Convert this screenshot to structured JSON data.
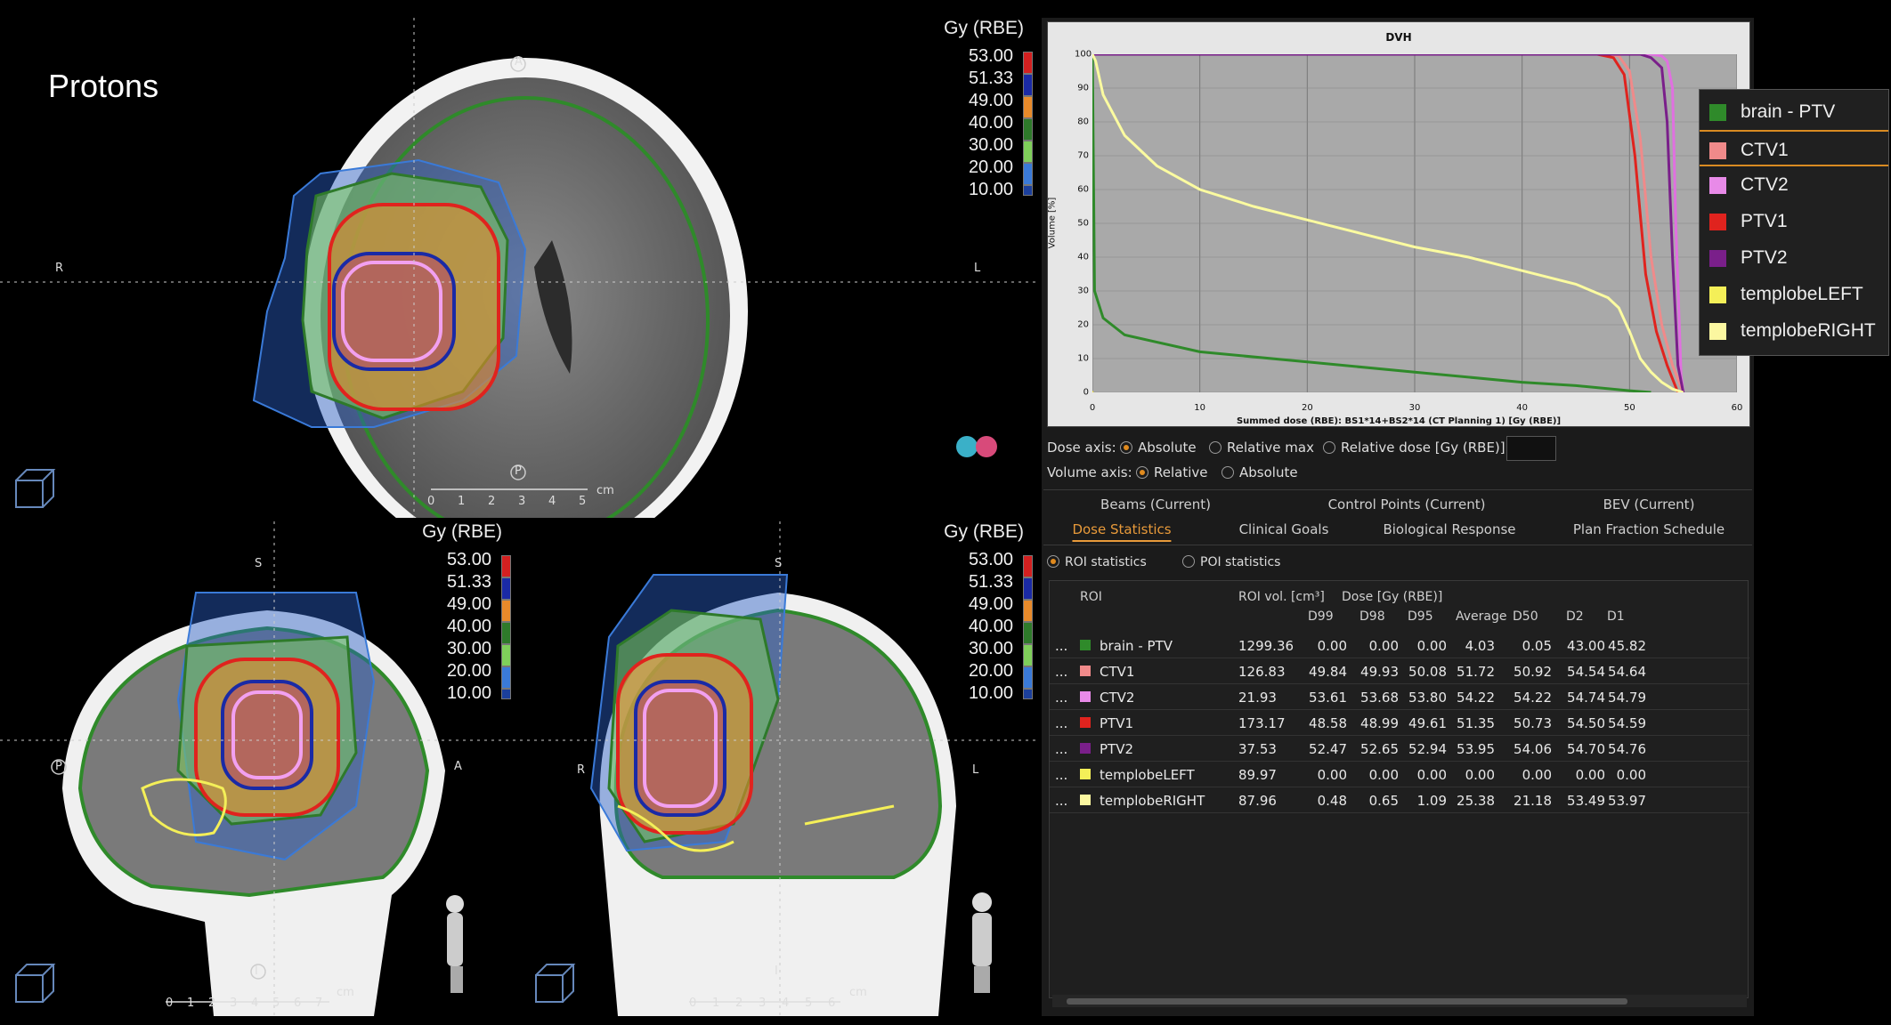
{
  "axial": {
    "title": "Protons",
    "orient": {
      "top": "A",
      "bottom": "P",
      "left": "R",
      "right": "L"
    },
    "ruler_unit": "cm",
    "ruler_ticks": [
      "0",
      "1",
      "2",
      "3",
      "4",
      "5"
    ]
  },
  "sagittal": {
    "orient": {
      "top": "S",
      "bottom": "I",
      "left": "P",
      "right": "A"
    },
    "ruler_unit": "cm",
    "ruler_ticks": [
      "0",
      "1",
      "2",
      "3",
      "4",
      "5",
      "6",
      "7"
    ]
  },
  "coronal": {
    "orient": {
      "top": "S",
      "bottom": "I",
      "left": "R",
      "right": "L"
    },
    "ruler_unit": "cm",
    "ruler_ticks": [
      "0",
      "1",
      "2",
      "3",
      "4",
      "5",
      "6"
    ]
  },
  "dose_legend": {
    "title": "Gy (RBE)",
    "levels": [
      "53.00",
      "51.33",
      "49.00",
      "40.00",
      "30.00",
      "20.00",
      "10.00"
    ],
    "colors": [
      "#d42020",
      "#1a2aa6",
      "#e88a2a",
      "#2e7a2a",
      "#7fcf5a",
      "#3a7ad8",
      "#1b3f9c"
    ]
  },
  "dvh": {
    "title": "DVH",
    "xlabel": "Summed dose (RBE): BS1*14+BS2*14 (CT Planning 1) [Gy (RBE)]",
    "ylabel": "Volume [%]",
    "xticks": [
      "0",
      "10",
      "20",
      "30",
      "40",
      "50",
      "60"
    ],
    "yticks": [
      "100",
      "90",
      "80",
      "70",
      "60",
      "50",
      "40",
      "30",
      "20",
      "10",
      "0"
    ]
  },
  "chart_data": {
    "type": "line",
    "title": "DVH",
    "xlabel": "Summed dose (RBE): BS1*14+BS2*14 (CT Planning 1) [Gy (RBE)]",
    "ylabel": "Volume [%]",
    "xlim": [
      0,
      60
    ],
    "ylim": [
      0,
      100
    ],
    "grid": true,
    "legend_placement": "right, outside",
    "series": [
      {
        "name": "brain - PTV",
        "color": "#2f8a2a",
        "x": [
          0,
          0.2,
          1,
          3,
          10,
          20,
          30,
          40,
          45,
          50,
          52
        ],
        "y": [
          100,
          30,
          22,
          17,
          12,
          9,
          6,
          3,
          2,
          0.5,
          0
        ]
      },
      {
        "name": "CTV1",
        "color": "#f08a8a",
        "x": [
          0,
          48,
          49,
          50,
          51,
          52,
          53,
          54,
          55
        ],
        "y": [
          100,
          100,
          99.5,
          95,
          75,
          40,
          20,
          8,
          0
        ]
      },
      {
        "name": "CTV2",
        "color": "#e070e0",
        "x": [
          0,
          52,
          53,
          53.5,
          54,
          54.3,
          54.8,
          55
        ],
        "y": [
          100,
          100,
          99.5,
          98,
          90,
          50,
          5,
          0
        ]
      },
      {
        "name": "PTV1",
        "color": "#e0231e",
        "x": [
          0,
          47,
          48.5,
          49.5,
          50.5,
          51.5,
          52.5,
          53.5,
          54.5
        ],
        "y": [
          100,
          100,
          99,
          94,
          70,
          35,
          18,
          8,
          0
        ]
      },
      {
        "name": "PTV2",
        "color": "#7a1f8a",
        "x": [
          0,
          51,
          52,
          53,
          53.5,
          54,
          54.5,
          55
        ],
        "y": [
          100,
          100,
          99,
          96,
          80,
          40,
          8,
          0
        ]
      },
      {
        "name": "templobeLEFT",
        "color": "#f0e040",
        "x": [
          0,
          0.1
        ],
        "y": [
          0,
          0
        ]
      },
      {
        "name": "templobeRIGHT",
        "color": "#fbfba0",
        "x": [
          0,
          0.3,
          1,
          3,
          6,
          10,
          15,
          20,
          25,
          30,
          35,
          40,
          45,
          48,
          49,
          50,
          51,
          52,
          53,
          54,
          55
        ],
        "y": [
          100,
          98,
          88,
          76,
          67,
          60,
          55,
          51,
          47,
          43,
          40,
          36,
          32,
          28,
          25,
          18,
          10,
          6,
          3,
          1,
          0
        ]
      }
    ]
  },
  "roi_legend": [
    {
      "name": "brain - PTV",
      "color": "#2f8a2a",
      "selected": false
    },
    {
      "name": "CTV1",
      "color": "#f08a8a",
      "selected": true
    },
    {
      "name": "CTV2",
      "color": "#e88ae8",
      "selected": false
    },
    {
      "name": "PTV1",
      "color": "#e0231e",
      "selected": false
    },
    {
      "name": "PTV2",
      "color": "#7a1f8a",
      "selected": false
    },
    {
      "name": "templobeLEFT",
      "color": "#f4ef58",
      "selected": false
    },
    {
      "name": "templobeRIGHT",
      "color": "#fbf7a0",
      "selected": false
    }
  ],
  "options": {
    "dose_axis_label": "Dose axis:",
    "dose_axis_opts": [
      "Absolute",
      "Relative max",
      "Relative dose [Gy (RBE)]:"
    ],
    "volume_axis_label": "Volume axis:",
    "volume_axis_opts": [
      "Relative",
      "Absolute"
    ],
    "dose_value": ""
  },
  "tabs_row1": [
    "Beams (Current)",
    "Control Points (Current)",
    "BEV (Current)"
  ],
  "tabs_row2": [
    "Dose Statistics",
    "Clinical Goals",
    "Biological Response",
    "Plan Fraction Schedule"
  ],
  "stats_mode": [
    "ROI statistics",
    "POI statistics"
  ],
  "table": {
    "headers": {
      "roi": "ROI",
      "vol": "ROI vol. [cm³]",
      "dose": "Dose [Gy (RBE)]"
    },
    "sub_headers": [
      "D99",
      "D98",
      "D95",
      "Average",
      "D50",
      "D2",
      "D1"
    ],
    "rows": [
      {
        "name": "brain - PTV",
        "color": "#2f8a2a",
        "vol": "1299.36",
        "vals": [
          "0.00",
          "0.00",
          "0.00",
          "4.03",
          "0.05",
          "43.00",
          "45.82"
        ]
      },
      {
        "name": "CTV1",
        "color": "#f08a8a",
        "vol": "126.83",
        "vals": [
          "49.84",
          "49.93",
          "50.08",
          "51.72",
          "50.92",
          "54.54",
          "54.64"
        ]
      },
      {
        "name": "CTV2",
        "color": "#e88ae8",
        "vol": "21.93",
        "vals": [
          "53.61",
          "53.68",
          "53.80",
          "54.22",
          "54.22",
          "54.74",
          "54.79"
        ]
      },
      {
        "name": "PTV1",
        "color": "#e0231e",
        "vol": "173.17",
        "vals": [
          "48.58",
          "48.99",
          "49.61",
          "51.35",
          "50.73",
          "54.50",
          "54.59"
        ]
      },
      {
        "name": "PTV2",
        "color": "#7a1f8a",
        "vol": "37.53",
        "vals": [
          "52.47",
          "52.65",
          "52.94",
          "53.95",
          "54.06",
          "54.70",
          "54.76"
        ]
      },
      {
        "name": "templobeLEFT",
        "color": "#f4ef58",
        "vol": "89.97",
        "vals": [
          "0.00",
          "0.00",
          "0.00",
          "0.00",
          "0.00",
          "0.00",
          "0.00"
        ]
      },
      {
        "name": "templobeRIGHT",
        "color": "#fbf7a0",
        "vol": "87.96",
        "vals": [
          "0.48",
          "0.65",
          "1.09",
          "25.38",
          "21.18",
          "53.49",
          "53.97"
        ]
      }
    ]
  }
}
